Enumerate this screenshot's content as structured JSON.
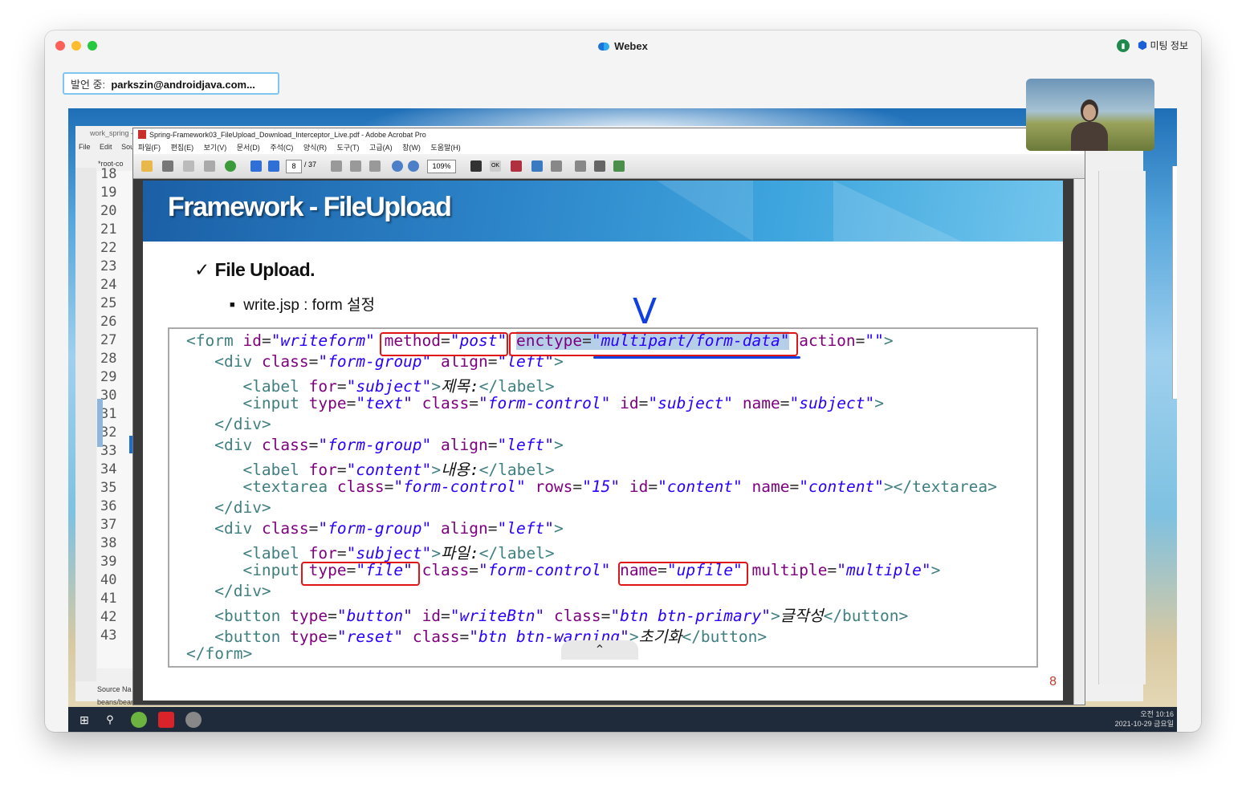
{
  "window": {
    "title": "Webex",
    "meeting_info": "미팅 정보",
    "speaking_label": "발언 중:",
    "speaker": "parkszin@androidjava.com..."
  },
  "eclipse": {
    "title": "work_spring -",
    "menu": [
      "File",
      "Edit",
      "Sour"
    ],
    "tab": "*root-co",
    "line_numbers": [
      "18",
      "19",
      "20",
      "21",
      "22",
      "23",
      "24",
      "25",
      "26",
      "27",
      "28",
      "29",
      "30",
      "31",
      "32",
      "33",
      "34",
      "35",
      "36",
      "37",
      "38",
      "39",
      "40",
      "41",
      "42",
      "43"
    ],
    "bottom_tabs": [
      "Source",
      "Na"
    ],
    "status_path": "beans/bean/#"
  },
  "acrobat": {
    "title": "Spring-Framework03_FileUpload_Download_Interceptor_Live.pdf - Adobe Acrobat Pro",
    "menu": [
      "파일(F)",
      "편집(E)",
      "보기(V)",
      "문서(D)",
      "주석(C)",
      "양식(R)",
      "도구(T)",
      "고급(A)",
      "창(W)",
      "도움말(H)"
    ],
    "current_page": "8",
    "total_pages": "/ 37",
    "zoom": "109%",
    "ok_label": "OK"
  },
  "slide": {
    "title": "Framework - FileUpload",
    "bullet1": "File Upload.",
    "bullet2": "write.jsp : form 설정",
    "page_number": "8",
    "pen_mark": "V"
  },
  "taskbar": {
    "time": "오전 10:16",
    "date": "2021-10-29 금요일"
  },
  "colors": {
    "tag": "#3f7f7f",
    "attr": "#7f007f",
    "value": "#2a00ff",
    "highlight_box": "#e01515",
    "pen": "#1040e0"
  }
}
